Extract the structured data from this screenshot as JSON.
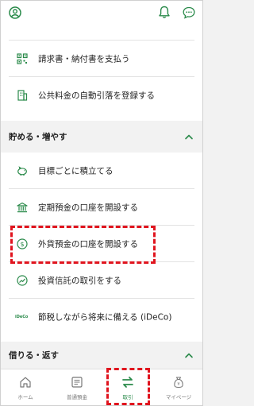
{
  "colors": {
    "accent": "#2a8a4a",
    "highlight": "#e0141e",
    "text": "#222222",
    "muted": "#777777"
  },
  "header": {
    "icons": [
      "profile-icon",
      "bell-icon",
      "chat-icon"
    ]
  },
  "top_card": {
    "items": [
      {
        "label": "請求書・納付書を支払う",
        "icon": "qr-code-icon"
      },
      {
        "label": "公共料金の自動引落を登録する",
        "icon": "building-icon"
      }
    ]
  },
  "sections": {
    "save": {
      "title": "貯める・増やす",
      "icon": "chevron-up-icon"
    },
    "borrow": {
      "title": "借りる・返す",
      "icon": "chevron-up-icon"
    }
  },
  "save_items": [
    {
      "label": "目標ごとに積立てる",
      "icon": "piggy-bank-icon"
    },
    {
      "label": "定期預金の口座を開設する",
      "icon": "bank-icon"
    },
    {
      "label": "外貨預金の口座を開設する",
      "icon": "dollar-coin-icon"
    },
    {
      "label": "投資信託の取引をする",
      "icon": "chart-circle-icon"
    },
    {
      "label": "節税しながら将来に備える (iDeCo)",
      "icon": "ideco-logo",
      "logo_text": "iDeCo"
    }
  ],
  "bottom_nav": {
    "items": [
      {
        "label": "ホーム",
        "icon": "home-icon",
        "active": false
      },
      {
        "label": "普通預金",
        "icon": "passbook-icon",
        "active": false
      },
      {
        "label": "取引",
        "icon": "transfer-arrows-icon",
        "active": true
      },
      {
        "label": "マイページ",
        "icon": "money-bag-icon",
        "active": false
      }
    ]
  }
}
